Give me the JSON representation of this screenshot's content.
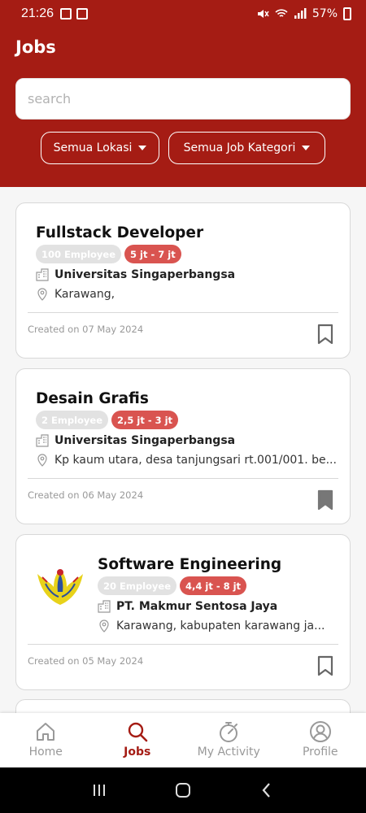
{
  "status_bar": {
    "time": "21:26",
    "battery": "57%"
  },
  "header": {
    "title": "Jobs",
    "search_placeholder": "search",
    "filter_location": "Semua Lokasi",
    "filter_category": "Semua Job Kategori"
  },
  "jobs": [
    {
      "title": "Fullstack Developer",
      "employees": "100 Employee",
      "salary": "5 jt - 7 jt",
      "company": "Universitas Singaperbangsa",
      "location": "Karawang,",
      "created": "Created on 07 May 2024",
      "bookmarked": false,
      "has_logo": false
    },
    {
      "title": "Desain Grafis",
      "employees": "2 Employee",
      "salary": "2,5 jt - 3 jt",
      "company": "Universitas Singaperbangsa",
      "location": "Kp kaum utara, desa tanjungsari rt.001/001. be...",
      "created": "Created on 06 May 2024",
      "bookmarked": true,
      "has_logo": false
    },
    {
      "title": "Software Engineering",
      "employees": "20 Employee",
      "salary": "4,4 jt - 8 jt",
      "company": "PT. Makmur Sentosa Jaya",
      "location": "Karawang, kabupaten karawang ja...",
      "created": "Created on 05 May 2024",
      "bookmarked": false,
      "has_logo": true
    }
  ],
  "bottom_nav": {
    "home": "Home",
    "jobs": "Jobs",
    "activity": "My Activity",
    "profile": "Profile"
  },
  "colors": {
    "primary": "#a51c14",
    "salary_badge": "#d95450",
    "employee_badge": "#e2e2e2"
  }
}
